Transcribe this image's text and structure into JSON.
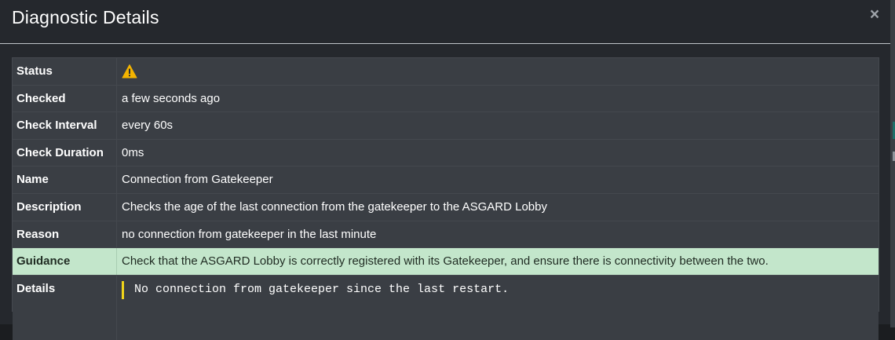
{
  "dialog": {
    "title": "Diagnostic Details",
    "close_label": "×"
  },
  "rows": [
    {
      "label": "Status",
      "value": "",
      "status_icon": "warning-icon",
      "status_color": "#f4b400"
    },
    {
      "label": "Checked",
      "value": "a few seconds ago"
    },
    {
      "label": "Check Interval",
      "value": "every 60s"
    },
    {
      "label": "Check Duration",
      "value": "0ms"
    },
    {
      "label": "Name",
      "value": "Connection from Gatekeeper"
    },
    {
      "label": "Description",
      "value": "Checks the age of the last connection from the gatekeeper to the ASGARD Lobby"
    },
    {
      "label": "Reason",
      "value": "no connection from gatekeeper in the last minute"
    },
    {
      "label": "Guidance",
      "value": "Check that the ASGARD Lobby is correctly registered with its Gatekeeper, and ensure there is connectivity between the two.",
      "highlight_color": "#c3e6cb"
    },
    {
      "label": "Details",
      "value": "No connection from gatekeeper since the last restart.",
      "accent_color": "#f1d51a"
    }
  ]
}
